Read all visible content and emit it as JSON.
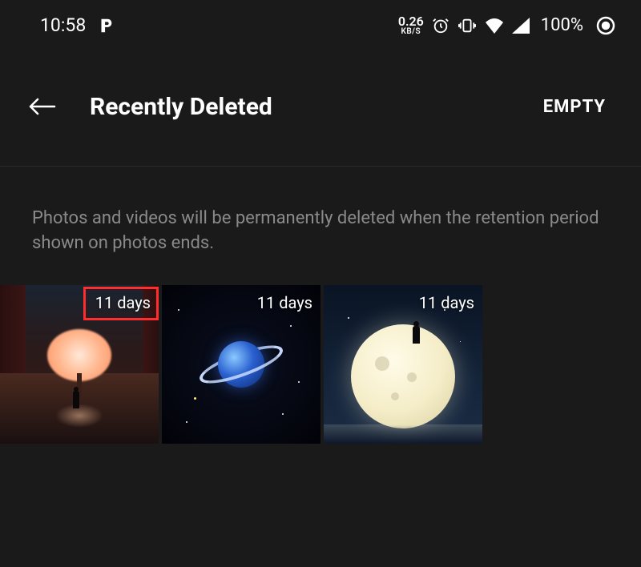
{
  "status": {
    "time": "10:58",
    "net_speed_value": "0.26",
    "net_speed_unit": "KB/S",
    "battery_pct": "100%"
  },
  "header": {
    "title": "Recently Deleted",
    "empty_label": "EMPTY"
  },
  "info_text": "Photos and videos will be permanently deleted when the retention period shown on photos ends.",
  "items": [
    {
      "days_label": "11 days",
      "highlighted": true
    },
    {
      "days_label": "11 days",
      "highlighted": false
    },
    {
      "days_label": "11 days",
      "highlighted": false
    }
  ]
}
